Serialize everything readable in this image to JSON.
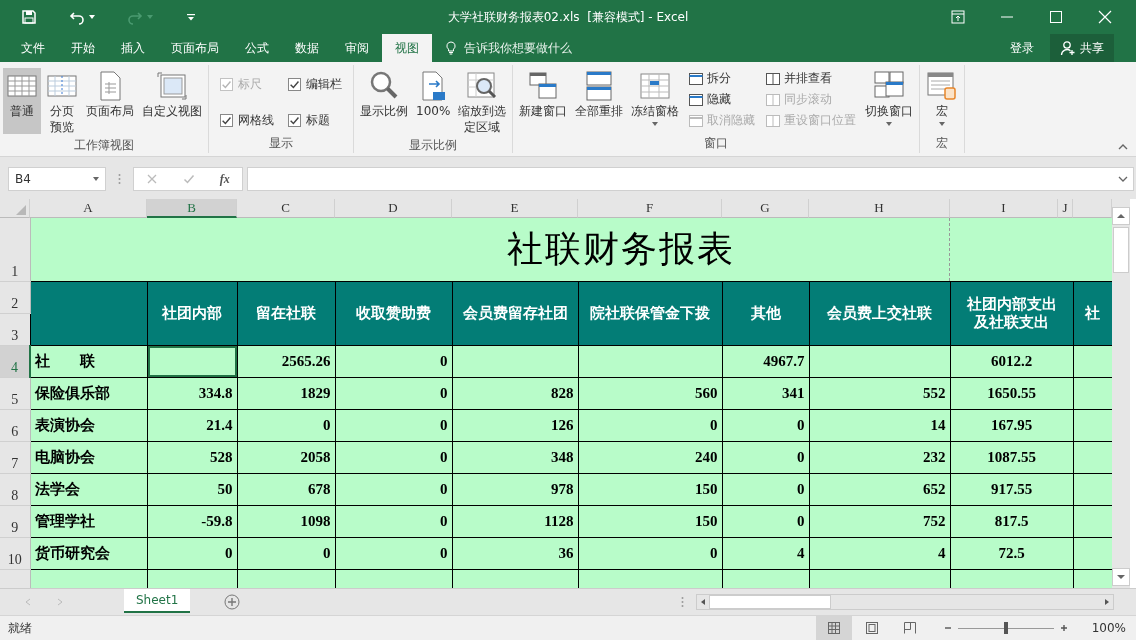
{
  "window": {
    "title": "大学社联财务报表02.xls  [兼容模式] - Excel"
  },
  "tabs": [
    {
      "label": "文件",
      "selected": false
    },
    {
      "label": "开始",
      "selected": false
    },
    {
      "label": "插入",
      "selected": false
    },
    {
      "label": "页面布局",
      "selected": false
    },
    {
      "label": "公式",
      "selected": false
    },
    {
      "label": "数据",
      "selected": false
    },
    {
      "label": "审阅",
      "selected": false
    },
    {
      "label": "视图",
      "selected": true
    }
  ],
  "tell_me": {
    "placeholder": "告诉我你想要做什么"
  },
  "account": {
    "sign_in": "登录",
    "share": "共享"
  },
  "ribbon": {
    "workbook_views": {
      "label": "工作簿视图",
      "buttons": [
        {
          "label": "普通",
          "selected": true
        },
        {
          "label": "分页预览",
          "selected": false
        },
        {
          "label": "页面布局",
          "selected": false
        },
        {
          "label": "自定义视图",
          "selected": false
        }
      ]
    },
    "show": {
      "label": "显示",
      "checkboxes": [
        {
          "label": "标尺",
          "checked": true,
          "disabled": true
        },
        {
          "label": "编辑栏",
          "checked": true,
          "disabled": false
        },
        {
          "label": "网格线",
          "checked": true,
          "disabled": false
        },
        {
          "label": "标题",
          "checked": true,
          "disabled": false
        }
      ]
    },
    "zoom": {
      "label": "显示比例",
      "buttons": [
        {
          "label": "显示比例"
        },
        {
          "label": "100%"
        },
        {
          "label": "缩放到选定区域"
        }
      ]
    },
    "window": {
      "label": "窗口",
      "buttons": [
        {
          "label": "新建窗口",
          "dropdown": false
        },
        {
          "label": "全部重排",
          "dropdown": false
        },
        {
          "label": "冻结窗格",
          "dropdown": true
        }
      ],
      "small_columns": [
        [
          {
            "label": "拆分",
            "disabled": false
          },
          {
            "label": "隐藏",
            "disabled": false
          },
          {
            "label": "取消隐藏",
            "disabled": true
          }
        ],
        [
          {
            "label": "并排查看",
            "disabled": false
          },
          {
            "label": "同步滚动",
            "disabled": true
          },
          {
            "label": "重设窗口位置",
            "disabled": true
          }
        ]
      ],
      "switch_button": {
        "label": "切换窗口",
        "dropdown": true
      }
    },
    "macros": {
      "label": "宏",
      "button": {
        "label": "宏",
        "dropdown": true
      }
    }
  },
  "formula_bar": {
    "name_box": "B4",
    "fx": "fx"
  },
  "sheet": {
    "columns": [
      {
        "label": "A",
        "selected": false
      },
      {
        "label": "B",
        "selected": true
      },
      {
        "label": "C",
        "selected": false
      },
      {
        "label": "D",
        "selected": false
      },
      {
        "label": "E",
        "selected": false
      },
      {
        "label": "F",
        "selected": false
      },
      {
        "label": "G",
        "selected": false
      },
      {
        "label": "H",
        "selected": false
      },
      {
        "label": "I",
        "selected": false
      },
      {
        "label": "J",
        "selected": false
      }
    ],
    "title_row": {
      "number": "1",
      "title": "社联财务报表"
    },
    "header_rows": {
      "numbers": [
        "2",
        "3"
      ],
      "headings": [
        "社团内部",
        "留在社联",
        "收取赞助费",
        "会员费留存社团",
        "院社联保管金下拨",
        "其他",
        "会员费上交社联",
        "社团内部支出及社联支出",
        "社"
      ]
    },
    "rows": [
      {
        "number": "4",
        "selected": true,
        "cells": [
          "社　　联",
          null,
          "2565.26",
          "0",
          null,
          null,
          "4967.7",
          null,
          "6012.2"
        ]
      },
      {
        "number": "5",
        "selected": false,
        "cells": [
          "保险俱乐部",
          "334.8",
          "1829",
          "0",
          "828",
          "560",
          "341",
          "552",
          "1650.55"
        ]
      },
      {
        "number": "6",
        "selected": false,
        "cells": [
          "表演协会",
          "21.4",
          "0",
          "0",
          "126",
          "0",
          "0",
          "14",
          "167.95"
        ]
      },
      {
        "number": "7",
        "selected": false,
        "cells": [
          "电脑协会",
          "528",
          "2058",
          "0",
          "348",
          "240",
          "0",
          "232",
          "1087.55"
        ]
      },
      {
        "number": "8",
        "selected": false,
        "cells": [
          "法学会",
          "50",
          "678",
          "0",
          "978",
          "150",
          "0",
          "652",
          "917.55"
        ]
      },
      {
        "number": "9",
        "selected": false,
        "cells": [
          "管理学社",
          "-59.8",
          "1098",
          "0",
          "1128",
          "150",
          "0",
          "752",
          "817.5"
        ]
      },
      {
        "number": "10",
        "selected": false,
        "cells": [
          "货币研究会",
          "0",
          "0",
          "0",
          "36",
          "0",
          "4",
          "4",
          "72.5"
        ]
      }
    ]
  },
  "sheet_tabs": [
    {
      "label": "Sheet1",
      "selected": true
    }
  ],
  "status_bar": {
    "status": "就绪",
    "views": [
      {
        "selected": true
      },
      {
        "selected": false
      },
      {
        "selected": false
      }
    ],
    "zoom": {
      "level": 0.5,
      "reading": "100%"
    }
  }
}
